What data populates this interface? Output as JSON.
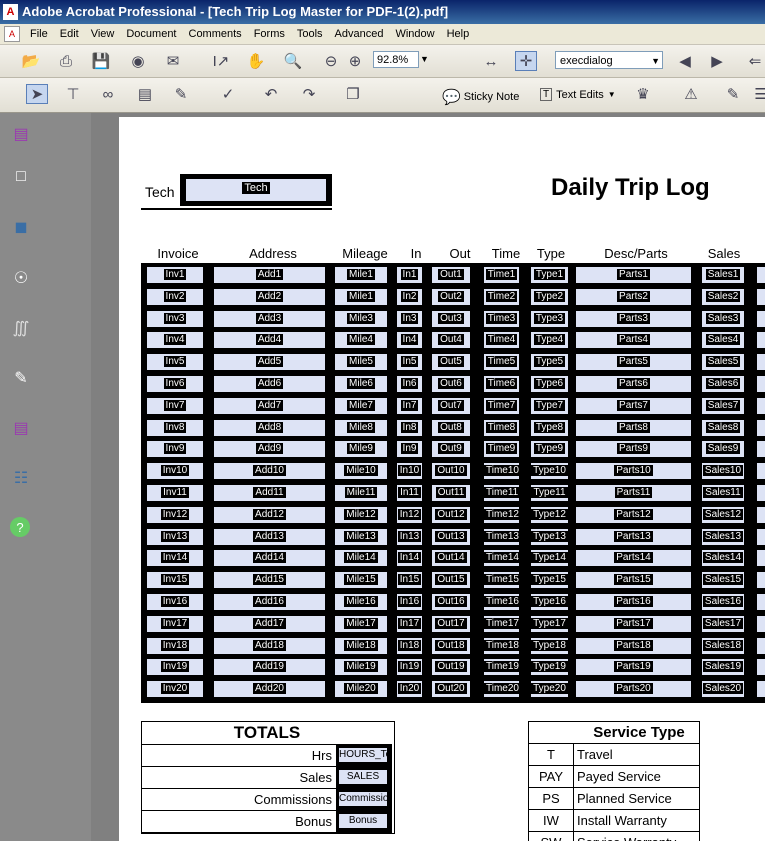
{
  "window": {
    "title": "Adobe Acrobat Professional - [Tech Trip Log Master for PDF-1(2).pdf]"
  },
  "menu": [
    "File",
    "Edit",
    "View",
    "Document",
    "Comments",
    "Forms",
    "Tools",
    "Advanced",
    "Window",
    "Help"
  ],
  "toolbar": {
    "zoom": "92.8%",
    "find_value": "execdialog",
    "sticky_note": "Sticky Note",
    "text_edits": "Text Edits"
  },
  "page": {
    "tech_label": "Tech",
    "tech_field": "Tech",
    "title": "Daily Trip Log",
    "columns": [
      "Invoice",
      "Address",
      "Mileage",
      "In",
      "Out",
      "Time",
      "Type",
      "Desc/Parts",
      "Sales",
      "C"
    ],
    "rows": [
      [
        "Inv1",
        "Add1",
        "Mile1",
        "In1",
        "Out1",
        "Time1",
        "Type1",
        "Parts1",
        "Sales1"
      ],
      [
        "Inv2",
        "Add2",
        "Mile1",
        "In2",
        "Out2",
        "Time2",
        "Type2",
        "Parts2",
        "Sales2"
      ],
      [
        "Inv3",
        "Add3",
        "Mile3",
        "In3",
        "Out3",
        "Time3",
        "Type3",
        "Parts3",
        "Sales3"
      ],
      [
        "Inv4",
        "Add4",
        "Mile4",
        "In4",
        "Out4",
        "Time4",
        "Type4",
        "Parts4",
        "Sales4"
      ],
      [
        "Inv5",
        "Add5",
        "Mile5",
        "In5",
        "Out5",
        "Time5",
        "Type5",
        "Parts5",
        "Sales5"
      ],
      [
        "Inv6",
        "Add6",
        "Mile6",
        "In6",
        "Out6",
        "Time6",
        "Type6",
        "Parts6",
        "Sales6"
      ],
      [
        "Inv7",
        "Add7",
        "Mile7",
        "In7",
        "Out7",
        "Time7",
        "Type7",
        "Parts7",
        "Sales7"
      ],
      [
        "Inv8",
        "Add8",
        "Mile8",
        "In8",
        "Out8",
        "Time8",
        "Type8",
        "Parts8",
        "Sales8"
      ],
      [
        "Inv9",
        "Add9",
        "Mile9",
        "In9",
        "Out9",
        "Time9",
        "Type9",
        "Parts9",
        "Sales9"
      ],
      [
        "Inv10",
        "Add10",
        "Mile10",
        "In10",
        "Out10",
        "Time10",
        "Type10",
        "Parts10",
        "Sales10"
      ],
      [
        "Inv11",
        "Add11",
        "Mile11",
        "In11",
        "Out11",
        "Time11",
        "Type11",
        "Parts11",
        "Sales11"
      ],
      [
        "Inv12",
        "Add12",
        "Mile12",
        "In12",
        "Out12",
        "Time12",
        "Type12",
        "Parts12",
        "Sales12"
      ],
      [
        "Inv13",
        "Add13",
        "Mile13",
        "In13",
        "Out13",
        "Time13",
        "Type13",
        "Parts13",
        "Sales13"
      ],
      [
        "Inv14",
        "Add14",
        "Mile14",
        "In14",
        "Out14",
        "Time14",
        "Type14",
        "Parts14",
        "Sales14"
      ],
      [
        "Inv15",
        "Add15",
        "Mile15",
        "In15",
        "Out15",
        "Time15",
        "Type15",
        "Parts15",
        "Sales15"
      ],
      [
        "Inv16",
        "Add16",
        "Mile16",
        "In16",
        "Out16",
        "Time16",
        "Type16",
        "Parts16",
        "Sales16"
      ],
      [
        "Inv17",
        "Add17",
        "Mile17",
        "In17",
        "Out17",
        "Time17",
        "Type17",
        "Parts17",
        "Sales17"
      ],
      [
        "Inv18",
        "Add18",
        "Mile18",
        "In18",
        "Out18",
        "Time18",
        "Type18",
        "Parts18",
        "Sales18"
      ],
      [
        "Inv19",
        "Add19",
        "Mile19",
        "In19",
        "Out19",
        "Time19",
        "Type19",
        "Parts19",
        "Sales19"
      ],
      [
        "Inv20",
        "Add20",
        "Mile20",
        "In20",
        "Out20",
        "Time20",
        "Type20",
        "Parts20",
        "Sales20"
      ]
    ],
    "totals": {
      "title": "TOTALS",
      "rows": [
        {
          "label": "Hrs",
          "field": "HOURS_To"
        },
        {
          "label": "Sales",
          "field": "SALES"
        },
        {
          "label": "Commissions",
          "field": "Commission"
        },
        {
          "label": "Bonus",
          "field": "Bonus"
        }
      ]
    },
    "service_type": {
      "title": "Service Type",
      "rows": [
        {
          "code": "T",
          "desc": "Travel"
        },
        {
          "code": "PAY",
          "desc": "Payed Service"
        },
        {
          "code": "PS",
          "desc": "Planned Service"
        },
        {
          "code": "IW",
          "desc": "Install Warranty"
        },
        {
          "code": "SW",
          "desc": "Service Warranty"
        }
      ]
    }
  },
  "colors": {
    "field_fill": "#dde3f5",
    "title_bar": "#0a246a",
    "doc_bg": "#808080"
  }
}
